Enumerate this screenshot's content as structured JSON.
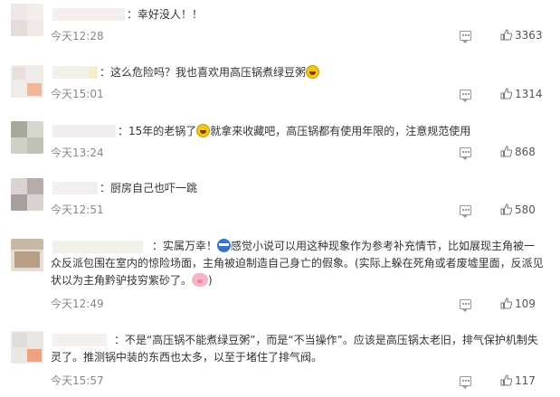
{
  "comments": [
    {
      "text": "：幸好没人！！",
      "time": "今天12:28",
      "likes": "3363"
    },
    {
      "text_before": "：这么危险吗？我也喜欢用高压锅煮绿豆粥",
      "emoji": "laugh-emoji",
      "time": "今天15:01",
      "likes": "1314"
    },
    {
      "text_before": "：15年的老锅了",
      "emoji": "laugh-emoji",
      "text_after": "就拿来收藏吧，高压锅都有使用年限的，注意规范使用",
      "time": "今天13:24",
      "likes": "868"
    },
    {
      "text": "：厨房自己也吓一跳",
      "time": "今天12:51",
      "likes": "580"
    },
    {
      "text_before": "：实属万幸！",
      "emoji": "glasses-emoji",
      "text_after": "感觉小说可以用这种现象作为参考补充情节，比如展现主角被一众反派包围在室内的惊险场面，主角被迫制造自己身亡的假象。(实际上躲在死角或者废墟里面，反派见状以为主角黔驴技穷紫砂了。",
      "emoji2": "pig-emoji",
      "text_end": ")",
      "time": "今天12:49",
      "likes": "109"
    },
    {
      "text": "：不是“高压锅不能煮绿豆粥”，而是“不当操作”。应该是高压锅太老旧，排气保护机制失灵了。推测锅中装的东西也太多，以至于堵住了排气阀。",
      "time": "今天15:57",
      "likes": "117"
    }
  ],
  "icons": {
    "reply": "comment-icon",
    "like": "thumbs-up-icon"
  }
}
